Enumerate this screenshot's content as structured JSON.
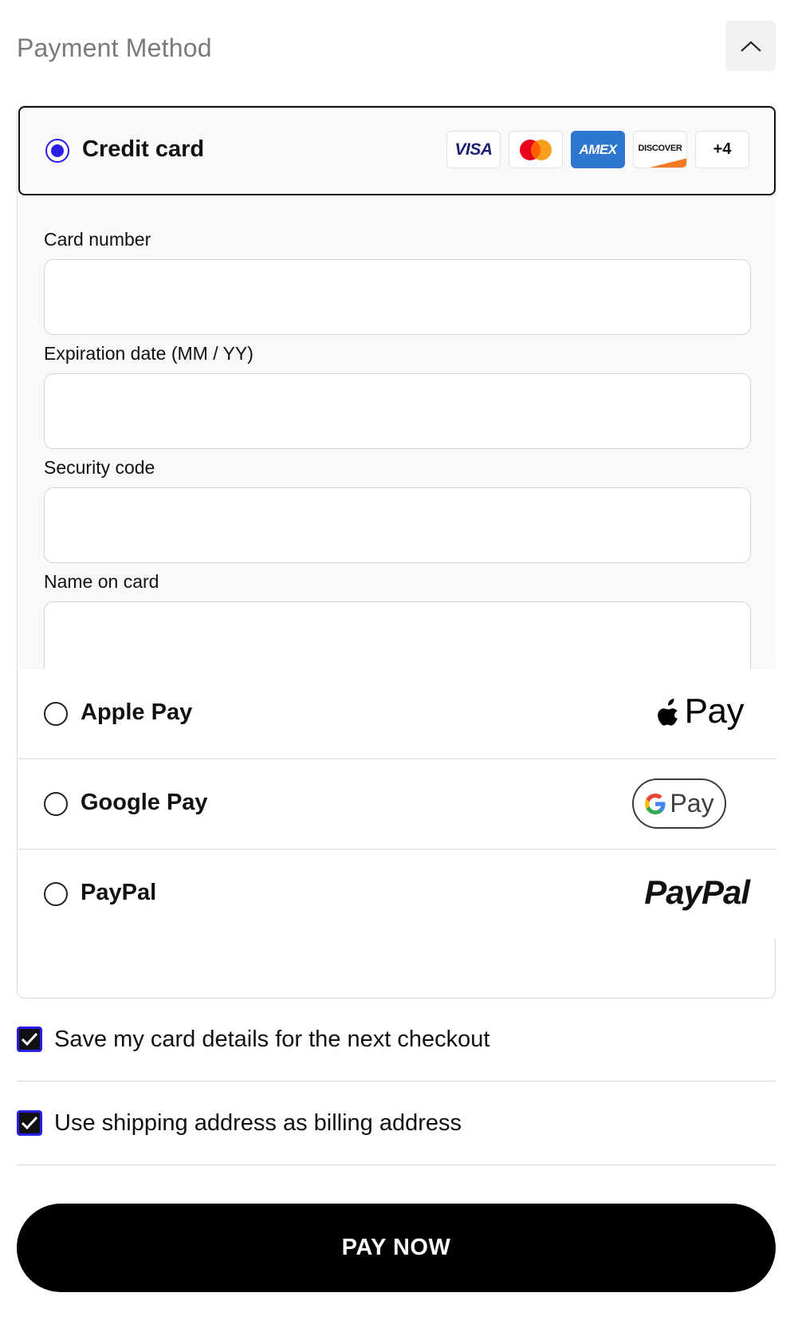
{
  "header": {
    "title": "Payment Method",
    "collapse_icon": "chevron-up-icon"
  },
  "credit_card": {
    "label": "Credit card",
    "selected": true,
    "brands": {
      "visa": "VISA",
      "mastercard_icon": "mastercard-icon",
      "amex": "AMEX",
      "discover": "DISCOVER",
      "more": "+4"
    },
    "fields": {
      "card_number": {
        "label": "Card number",
        "value": ""
      },
      "expiration": {
        "label": "Expiration date (MM / YY)",
        "value": ""
      },
      "security_code": {
        "label": "Security code",
        "value": ""
      },
      "name_on_card": {
        "label": "Name on card",
        "value": ""
      }
    }
  },
  "apple_pay": {
    "label": "Apple Pay",
    "logo_text": "Pay",
    "logo_icon": "apple-icon",
    "selected": false
  },
  "google_pay": {
    "label": "Google Pay",
    "logo_text": "Pay",
    "logo_icon": "google-g-icon",
    "selected": false
  },
  "paypal": {
    "label": "PayPal",
    "logo_text": "PayPal",
    "selected": false
  },
  "options": {
    "save_card": {
      "label": "Save my card details for the next checkout",
      "checked": true
    },
    "billing_same": {
      "label": "Use shipping address as billing address",
      "checked": true
    }
  },
  "pay_button": {
    "label": "PAY NOW"
  },
  "colors": {
    "accent": "#2a1ee6",
    "amex_blue": "#2e77d0",
    "button_bg": "#000000",
    "panel_bg": "#f8f9fb"
  }
}
